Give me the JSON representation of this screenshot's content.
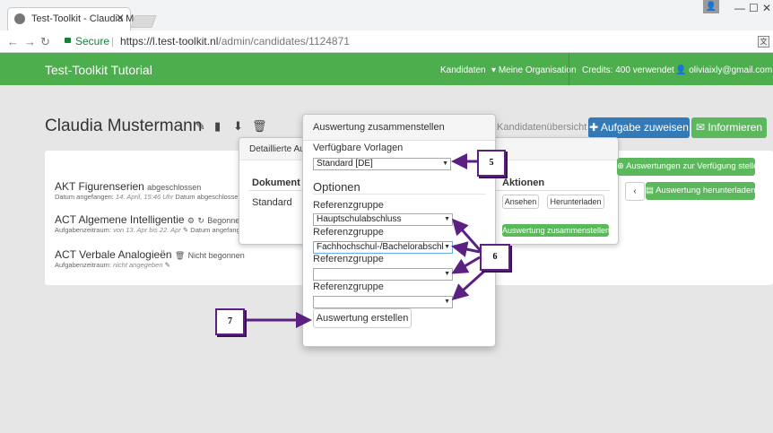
{
  "browser": {
    "tab_title": "Test-Toolkit - Claudia Mu",
    "secure_label": "Secure",
    "url_host": "https://l.test-toolkit.nl",
    "url_path": "/admin/candidates/1124871",
    "translate_glyph": "文"
  },
  "app": {
    "brand": "Test-Toolkit Tutorial",
    "nav": {
      "kandidaten": "Kandidaten",
      "organisation": "Meine Organisation",
      "credits": "Credits: 400 verwendet",
      "user": "oliviaixly@gmail.com"
    }
  },
  "page": {
    "candidate_name": "Claudia Mustermann",
    "overview_link": "Kandidatenübersicht",
    "assign_button": "Aufgabe zuweisen",
    "inform_button": "Informieren",
    "make_available_button": "Auswertungen zur Verfügung stellen",
    "download_eval_button": "Auswertung herunterladen",
    "tests": [
      {
        "name": "AKT Figurenserien",
        "status": "abgeschlossen",
        "meta_a": "Datum angefangen:",
        "meta_a_val": "14. April, 15:46 Uhr",
        "meta_b": "Datum abgeschlossen:"
      },
      {
        "name": "ACT Algemene Intelligentie",
        "status": "Begonnen",
        "meta_a": "Aufgabenzeitraum:",
        "meta_a_val": "von 13. Apr bis 22. Apr",
        "meta_b": "Datum angefange"
      },
      {
        "name": "ACT Verbale Analogieën",
        "status": "Nicht begonnen",
        "meta_a": "Aufgabenzeitraum:",
        "meta_a_val": "nicht angegeben",
        "meta_b": ""
      }
    ]
  },
  "detail_modal": {
    "title": "Detaillierte Au",
    "col_document": "Dokument",
    "col_actions": "Aktionen",
    "row_document": "Standard",
    "view_button": "Ansehen",
    "download_button": "Herunterladen",
    "compose_button": "Auswertung zusammenstellen"
  },
  "dialog": {
    "title": "Auswertung zusammenstellen",
    "templates_label": "Verfügbare Vorlagen",
    "template_value": "Standard [DE]",
    "options_heading": "Optionen",
    "ref_label": "Referenzgruppe",
    "ref_values": [
      "Hauptschulabschluss",
      "Fachhochschul-/Bachelorabschl",
      "",
      ""
    ],
    "create_button": "Auswertung erstellen"
  },
  "callouts": {
    "c5": "5",
    "c6": "6",
    "c7": "7"
  },
  "colors": {
    "accent_green": "#4cae4c",
    "primary_blue": "#337ab7",
    "callout_purple": "#5c1f82"
  }
}
